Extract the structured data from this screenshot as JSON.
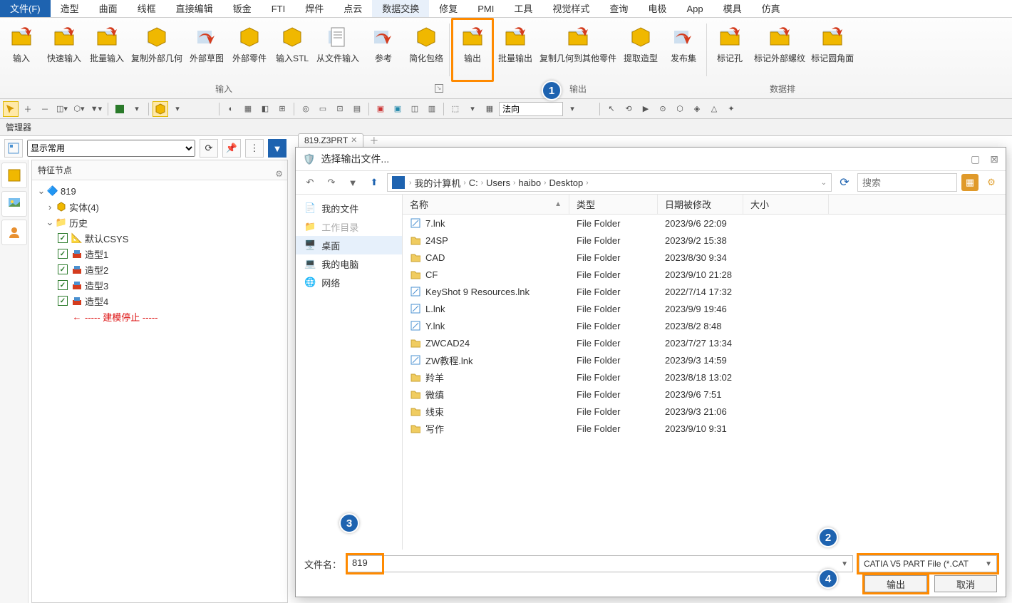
{
  "menu": {
    "file": "文件(F)",
    "items": [
      "造型",
      "曲面",
      "线框",
      "直接编辑",
      "钣金",
      "FTI",
      "焊件",
      "点云",
      "数据交换",
      "修复",
      "PMI",
      "工具",
      "视觉样式",
      "查询",
      "电极",
      "App",
      "模具",
      "仿真"
    ],
    "activeIndex": 8
  },
  "ribbon": {
    "g1": {
      "label": "输入",
      "buttons": [
        "输入",
        "快速输入",
        "批量输入",
        "复制外部几何",
        "外部草图",
        "外部零件",
        "输入STL",
        "从文件输入",
        "参考",
        "简化包络"
      ]
    },
    "g2": {
      "label": "输出",
      "buttons": [
        "输出",
        "批量输出",
        "复制几何到其他零件",
        "提取造型",
        "发布集"
      ]
    },
    "g3": {
      "label": "数据排",
      "buttons": [
        "标记孔",
        "标记外部螺纹",
        "标记圆角面"
      ]
    }
  },
  "callouts": {
    "1": "1",
    "2": "2",
    "3": "3",
    "4": "4"
  },
  "managerTitle": "管理器",
  "displayMode": "显示常用",
  "docTab": "819.Z3PRT",
  "tree": {
    "header": "特征节点",
    "root": "819",
    "solids": "实体(4)",
    "history": "历史",
    "csys": "默认CSYS",
    "shapes": [
      "造型1",
      "造型2",
      "造型3",
      "造型4"
    ],
    "stop": "----- 建模停止 -----"
  },
  "toolbarDropdown": "法向",
  "dialog": {
    "title": "选择输出文件...",
    "crumbs": [
      "我的计算机",
      "C:",
      "Users",
      "haibo",
      "Desktop"
    ],
    "searchPlaceholder": "搜索",
    "side": {
      "mydocs": "我的文件",
      "workdir": "工作目录",
      "desktop": "桌面",
      "mypc": "我的电脑",
      "network": "网络"
    },
    "cols": {
      "name": "名称",
      "type": "类型",
      "date": "日期被修改",
      "size": "大小"
    },
    "rows": [
      {
        "n": "7.lnk",
        "t": "File Folder",
        "d": "2023/9/6 22:09",
        "k": "lnk"
      },
      {
        "n": "24SP",
        "t": "File Folder",
        "d": "2023/9/2 15:38",
        "k": "dir"
      },
      {
        "n": "CAD",
        "t": "File Folder",
        "d": "2023/8/30 9:34",
        "k": "dir"
      },
      {
        "n": "CF",
        "t": "File Folder",
        "d": "2023/9/10 21:28",
        "k": "dir"
      },
      {
        "n": "KeyShot 9 Resources.lnk",
        "t": "File Folder",
        "d": "2022/7/14 17:32",
        "k": "lnk"
      },
      {
        "n": "L.lnk",
        "t": "File Folder",
        "d": "2023/9/9 19:46",
        "k": "lnk"
      },
      {
        "n": "Y.lnk",
        "t": "File Folder",
        "d": "2023/8/2 8:48",
        "k": "lnk"
      },
      {
        "n": "ZWCAD24",
        "t": "File Folder",
        "d": "2023/7/27 13:34",
        "k": "dir"
      },
      {
        "n": "ZW教程.lnk",
        "t": "File Folder",
        "d": "2023/9/3 14:59",
        "k": "lnk"
      },
      {
        "n": "羚羊",
        "t": "File Folder",
        "d": "2023/8/18 13:02",
        "k": "dir"
      },
      {
        "n": "微缜",
        "t": "File Folder",
        "d": "2023/9/6 7:51",
        "k": "dir"
      },
      {
        "n": "线束",
        "t": "File Folder",
        "d": "2023/9/3 21:06",
        "k": "dir"
      },
      {
        "n": "写作",
        "t": "File Folder",
        "d": "2023/9/10 9:31",
        "k": "dir"
      }
    ],
    "fnameLabel": "文件名：",
    "fnameValue": "819",
    "ftype": "CATIA V5 PART File (*.CAT",
    "btnExport": "输出",
    "btnCancel": "取消"
  }
}
